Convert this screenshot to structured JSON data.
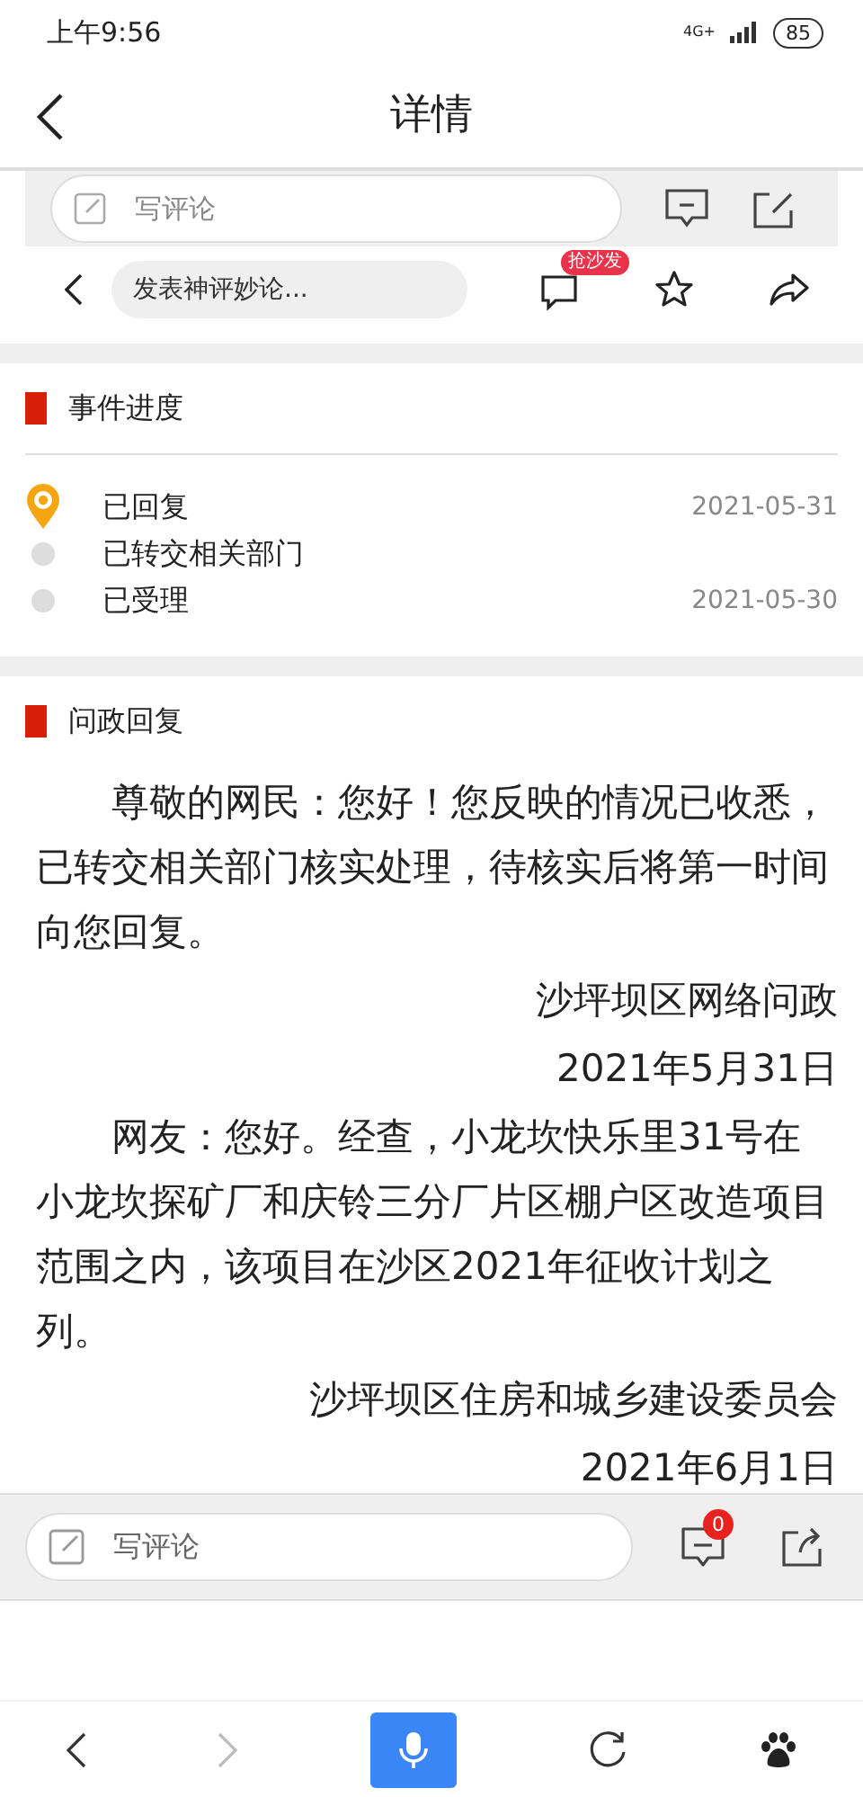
{
  "status_bar": {
    "time": "上午9:56",
    "network": "4G+",
    "battery": "85"
  },
  "header": {
    "title": "详情"
  },
  "embedded_toolbar_cut": {
    "placeholder": "写评论"
  },
  "embedded_toolbar": {
    "placeholder": "发表神评妙论...",
    "comment_badge": "抢沙发"
  },
  "progress": {
    "title": "事件进度",
    "steps": [
      {
        "label": "已回复",
        "date": "2021-05-31",
        "current": true
      },
      {
        "label": "已转交相关部门",
        "current": false
      },
      {
        "label": "已受理",
        "date": "2021-05-30",
        "current": false
      }
    ]
  },
  "reply": {
    "title": "问政回复",
    "blocks": [
      {
        "kind": "body",
        "text": "尊敬的网民：您好！您反映的情况已收悉，已转交相关部门核实处理，待核实后将第一时间向您回复。"
      },
      {
        "kind": "signature",
        "text": "沙坪坝区网络问政"
      },
      {
        "kind": "signature",
        "text": "2021年5月31日"
      },
      {
        "kind": "body",
        "text": "网友：您好。经查，小龙坎快乐里31号在小龙坎探矿厂和庆铃三分厂片区棚户区改造项目范围之内，该项目在沙区2021年征收计划之列。"
      },
      {
        "kind": "signature",
        "text": "沙坪坝区住房和城乡建设委员会"
      },
      {
        "kind": "signature",
        "text": "2021年6月1日"
      }
    ]
  },
  "comment_bar": {
    "placeholder": "写评论",
    "comment_count": "0"
  },
  "browser_nav": {
    "back_disabled": false,
    "forward_disabled": true
  }
}
